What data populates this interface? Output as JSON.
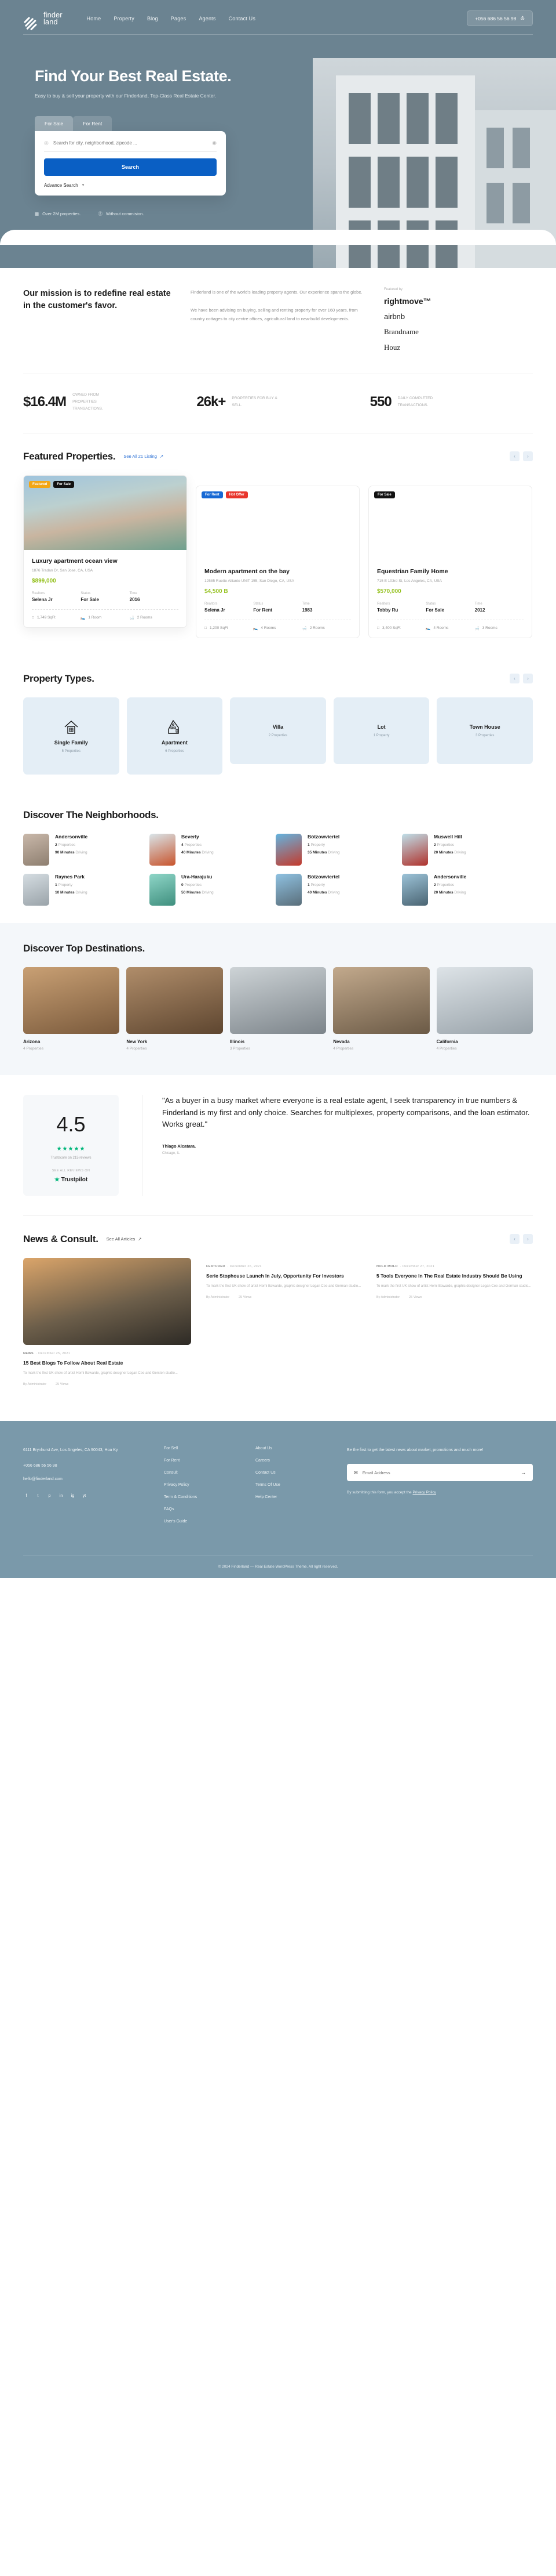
{
  "header": {
    "logo_line1": "finder",
    "logo_line2": "land",
    "nav": [
      {
        "label": "Home"
      },
      {
        "label": "Property"
      },
      {
        "label": "Blog"
      },
      {
        "label": "Pages"
      },
      {
        "label": "Agents"
      },
      {
        "label": "Contact Us"
      }
    ],
    "phone": "+056 686 56 56 98"
  },
  "hero": {
    "title": "Find Your Best Real Estate.",
    "subtitle": "Easy to buy & sell your property with our Finderland, Top-Class Real Estate Center.",
    "tab_sale": "For Sale",
    "tab_rent": "For Rent",
    "search_placeholder": "Search for city, neighborhood, zipcode ...",
    "search_button": "Search",
    "advance_search": "Advance Search",
    "stat1": "Over 2M properties.",
    "stat2": "Without commision."
  },
  "mission": {
    "heading": "Our mission is to redefine real estate in the customer's favor.",
    "para1": "Finderland is one of the world's leading property agents. Our experience spans the globe.",
    "para2": "We have been advising on buying, selling and renting property for over 160 years, from country cottages to city centre offices, agricultural land to new-build developments.",
    "featured_label": "Featured by",
    "brands": [
      "rightmove™",
      "airbnb",
      "Brandname",
      "Houz"
    ]
  },
  "stats": [
    {
      "num": "$16.4M",
      "label": "OWNED FROM PROPERTIES TRANSACTIONS."
    },
    {
      "num": "26k+",
      "label": "PROPERTIES FOR BUY & SELL."
    },
    {
      "num": "550",
      "label": "DAILY COMPLETED TRANSACTIONS."
    }
  ],
  "featured": {
    "title": "Featured Properties.",
    "see_all": "See All 21 Listing",
    "labels": {
      "realtors": "Realtors",
      "status": "Status",
      "time": "Time"
    },
    "cards": [
      {
        "badges": [
          "Featured",
          "For Sale"
        ],
        "title": "Luxury apartment ocean view",
        "address": "1876 Tradan Dr, San Jose, CA, USA",
        "price": "$899,000",
        "realtor": "Selena Jr",
        "status": "For Sale",
        "time": "2016",
        "sqft": "1,749 SqFt",
        "rooms": "1 Room",
        "baths": "2 Rooms"
      },
      {
        "badges": [
          "For Rent",
          "Hot Offer"
        ],
        "title": "Modern apartment on the bay",
        "address": "12585 Ruette Alliante UNIT 155, San Diego, CA, USA",
        "price": "$4,500 B",
        "realtor": "Selena Jr",
        "status": "For Rent",
        "time": "1983",
        "sqft": "1,200 SqFt",
        "rooms": "4 Rooms",
        "baths": "2 Rooms"
      },
      {
        "badges": [
          "For Sale"
        ],
        "title": "Equestrian Family Home",
        "address": "715 E 103rd St, Los Angeles, CA, USA",
        "price": "$570,000",
        "realtor": "Tobby Ru",
        "status": "For Sale",
        "time": "2012",
        "sqft": "3,400 SqFt",
        "rooms": "4 Rooms",
        "baths": "3 Rooms"
      }
    ]
  },
  "property_types": {
    "title": "Property Types.",
    "items": [
      {
        "name": "Single Family",
        "count": "5 Properties",
        "icon": "house-icon"
      },
      {
        "name": "Apartment",
        "count": "6 Properties",
        "icon": "apartment-icon"
      },
      {
        "name": "Villa",
        "count": "2 Properties",
        "icon": ""
      },
      {
        "name": "Lot",
        "count": "1 Property",
        "icon": ""
      },
      {
        "name": "Town House",
        "count": "3 Properties",
        "icon": ""
      }
    ]
  },
  "neighborhoods": {
    "title": "Discover The Neighborhoods.",
    "items": [
      {
        "name": "Andersonville",
        "props": "2",
        "props_lbl": "Properties",
        "time": "90 Minutes",
        "drive": "Driving",
        "c1": "#c9b8aa",
        "c2": "#8e7f70"
      },
      {
        "name": "Beverly",
        "props": "4",
        "props_lbl": "Properties",
        "time": "40 Minutes",
        "drive": "Driving",
        "c1": "#d9e5ea",
        "c2": "#c8542c"
      },
      {
        "name": "Bötzowviertel",
        "props": "1",
        "props_lbl": "Property",
        "time": "35 Minutes",
        "drive": "Driving",
        "c1": "#63b4e0",
        "c2": "#c43a2c"
      },
      {
        "name": "Muswell Hill",
        "props": "2",
        "props_lbl": "Properties",
        "time": "20 Minutes",
        "drive": "Driving",
        "c1": "#bfe0ea",
        "c2": "#b0322c"
      },
      {
        "name": "Raynes Park",
        "props": "1",
        "props_lbl": "Property",
        "time": "10 Minutes",
        "drive": "Driving",
        "c1": "#d5dde2",
        "c2": "#9aa3a9"
      },
      {
        "name": "Ura-Harajuku",
        "props": "0",
        "props_lbl": "Properties",
        "time": "50 Minutes",
        "drive": "Driving",
        "c1": "#8fd6c8",
        "c2": "#3f8f7e"
      },
      {
        "name": "Bötzowviertel",
        "props": "1",
        "props_lbl": "Property",
        "time": "40 Minutes",
        "drive": "Driving",
        "c1": "#8fc2e2",
        "c2": "#5a6e7a"
      },
      {
        "name": "Andersonville",
        "props": "2",
        "props_lbl": "Properties",
        "time": "20 Minutes",
        "drive": "Driving",
        "c1": "#9cc3d8",
        "c2": "#4a6472"
      }
    ]
  },
  "destinations": {
    "title": "Discover Top Destinations.",
    "items": [
      {
        "name": "Arizona",
        "count": "4 Properties",
        "c1": "#c9a074",
        "c2": "#7a5a3c"
      },
      {
        "name": "New York",
        "count": "4 Properties",
        "c1": "#b08d6a",
        "c2": "#5e4630"
      },
      {
        "name": "Illinois",
        "count": "3 Properties",
        "c1": "#cdd3d6",
        "c2": "#7c848a"
      },
      {
        "name": "Nevada",
        "count": "4 Properties",
        "c1": "#c2a98c",
        "c2": "#6b5a46"
      },
      {
        "name": "California",
        "count": "4 Properties",
        "c1": "#dde3e7",
        "c2": "#98a2a9"
      }
    ]
  },
  "testimonial": {
    "score": "4.5",
    "stars": "★★★★★",
    "reviews": "Trustscore on 215 reviews",
    "see_all": "SEE ALL REVIEWS ON",
    "brand": "Trustpilot",
    "quote": "\"As a buyer in a busy market where everyone is a real estate agent, I seek transparency in true numbers & Finderland is my first and only choice. Searches for multiplexes, property comparisons, and the loan estimator. Works great.\"",
    "author": "Thiago Alcatara.",
    "location": "Chicago, IL"
  },
  "news": {
    "title": "News & Consult.",
    "see_all": "See All Articles",
    "main": {
      "category": "NEWS",
      "date": "December 25, 2021",
      "title": "15 Best Blogs To Follow About Real Estate",
      "excerpt": "To mark the first UK show of artist Hemi Bawarde, graphic designer Logan Cee and Gersten studio...",
      "author": "By Administrator",
      "views": "25 Views"
    },
    "side": [
      {
        "category": "FEATURED",
        "date": "December 26, 2021",
        "title": "Serie Stophouse Launch In July, Opportunity For Investors",
        "excerpt": "To mark the first UK show of artist Hemi Bawarde, graphic designer Logan Cee and German studio...",
        "author": "By Administrator",
        "views": "25 Views"
      },
      {
        "category": "HOLD MOLD",
        "date": "December 27, 2021",
        "title": "5 Tools Everyone In The Real Estate Industry Should Be Using",
        "excerpt": "To mark the first UK show of artist Hemi Bawarde, graphic designer Logan Cee and German studio...",
        "author": "By Administrator",
        "views": "25 Views"
      }
    ]
  },
  "footer": {
    "address": "6111 Brynhurst Ave, Los Angeles, CA 90043, Hoa Ky",
    "phone": "+056 686 56 56 98",
    "email": "hello@finderland.com",
    "socials": [
      "f",
      "t",
      "p",
      "in",
      "ig",
      "yt"
    ],
    "col2": [
      "For Sell",
      "For Rent",
      "Consult",
      "Privacy Policy",
      "Term & Conditions",
      "FAQs",
      "User's Guide"
    ],
    "col3": [
      "About Us",
      "Careers",
      "Contact Us",
      "Terms Of Use",
      "Help Center"
    ],
    "newsletter_text": "Be the first to get the latest news about market, promotions and much more!",
    "email_placeholder": "Email Address",
    "privacy_note_pre": "By submitting this form, you accept the ",
    "privacy_note_link": "Privacy Policy",
    "copyright": "© 2024 Finderland — Real Estate WordPress Theme. All right reserved."
  }
}
